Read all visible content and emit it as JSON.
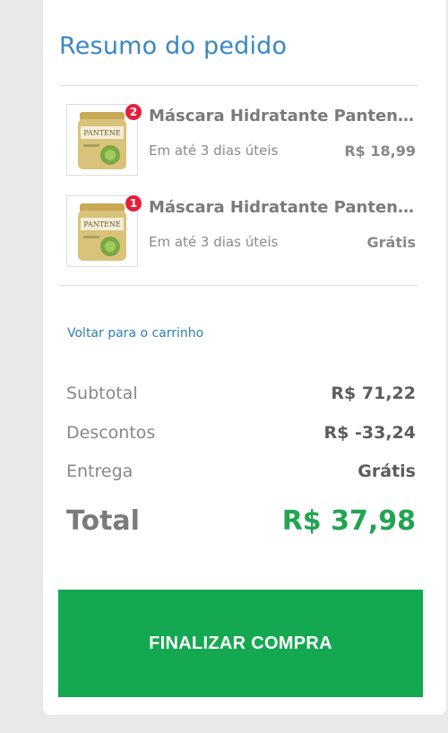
{
  "summary": {
    "title": "Resumo do pedido",
    "items": [
      {
        "badge": "2",
        "name": "Máscara Hidratante Pantene Restauração",
        "shipping": "Em até 3 dias úteis",
        "price": "R$ 18,99",
        "image_icon": "pantene-jar-image"
      },
      {
        "badge": "1",
        "name": "Máscara Hidratante Pantene Restauração",
        "shipping": "Em até 3 dias úteis",
        "price": "Grátis",
        "image_icon": "pantene-jar-image"
      }
    ],
    "back_link": "Voltar para o carrinho",
    "subtotal": {
      "label": "Subtotal",
      "value": "R$ 71,22"
    },
    "discounts": {
      "label": "Descontos",
      "value": "R$ -33,24"
    },
    "delivery": {
      "label": "Entrega",
      "value": "Grátis"
    },
    "total": {
      "label": "Total",
      "value": "R$ 37,98"
    },
    "checkout_button": "FINALIZAR COMPRA"
  },
  "colors": {
    "title": "#3a86c5",
    "badge": "#e41f3b",
    "total_value": "#22a452",
    "button": "#14a850",
    "link": "#2f7fb5"
  }
}
